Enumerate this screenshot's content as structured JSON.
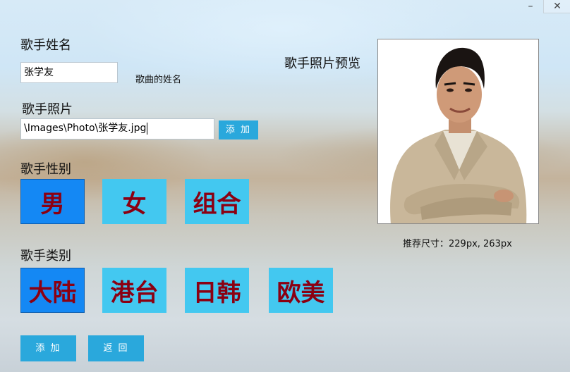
{
  "window": {
    "minimize_symbol": "–",
    "close_symbol": "✕"
  },
  "form": {
    "name_label": "歌手姓名",
    "name_value": "张学友",
    "name_hint": "歌曲的姓名",
    "photo_label": "歌手照片",
    "photo_path": "\\Images\\Photo\\张学友.jpg",
    "photo_add_button": "添 加",
    "gender_label": "歌手性别",
    "gender_options": [
      "男",
      "女",
      "组合"
    ],
    "gender_selected": "男",
    "category_label": "歌手类别",
    "category_options": [
      "大陆",
      "港台",
      "日韩",
      "欧美"
    ],
    "category_selected": "大陆",
    "submit_button": "添 加",
    "back_button": "返 回"
  },
  "preview": {
    "label": "歌手照片预览",
    "size_hint": "推荐尺寸：229px, 263px"
  },
  "colors": {
    "tile": "#43c8f0",
    "tile_selected": "#1488f4",
    "tile_text": "#8b0012",
    "button": "#2aa8dc"
  }
}
